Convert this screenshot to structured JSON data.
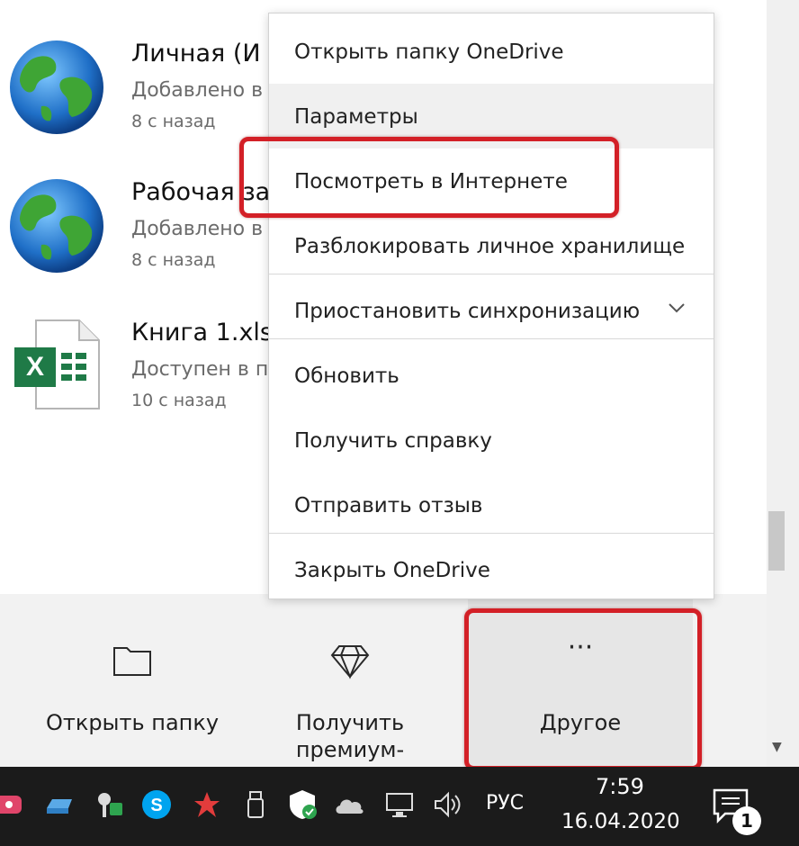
{
  "files": [
    {
      "name": "Личная (И",
      "status": "Добавлено в",
      "time": "8 с назад",
      "icon": "globe-icon"
    },
    {
      "name": "Рабочая за",
      "status": "Добавлено в",
      "time": "8 с назад",
      "icon": "globe-icon"
    },
    {
      "name": "Книга 1.xls",
      "status": "Доступен в п",
      "time": "10 с назад",
      "icon": "excel-file-icon"
    }
  ],
  "menu": {
    "items": [
      "Открыть папку OneDrive",
      "Параметры",
      "Посмотреть в Интернете",
      "Разблокировать личное хранилище",
      "Приостановить синхронизацию",
      "Обновить",
      "Получить справку",
      "Отправить отзыв",
      "Закрыть OneDrive"
    ]
  },
  "toolbar": {
    "open_folder": "Открыть папку",
    "premium": "Получить премиум-",
    "more": "Другое",
    "more_icon": "···"
  },
  "taskbar": {
    "lang": "РУС",
    "time": "7:59",
    "date": "16.04.2020",
    "notifications": "1"
  },
  "colors": {
    "highlight": "#d32027",
    "taskbar": "#1b1b1b",
    "toolbar": "#f2f2f2",
    "menu_hover": "#f0f0f0"
  }
}
